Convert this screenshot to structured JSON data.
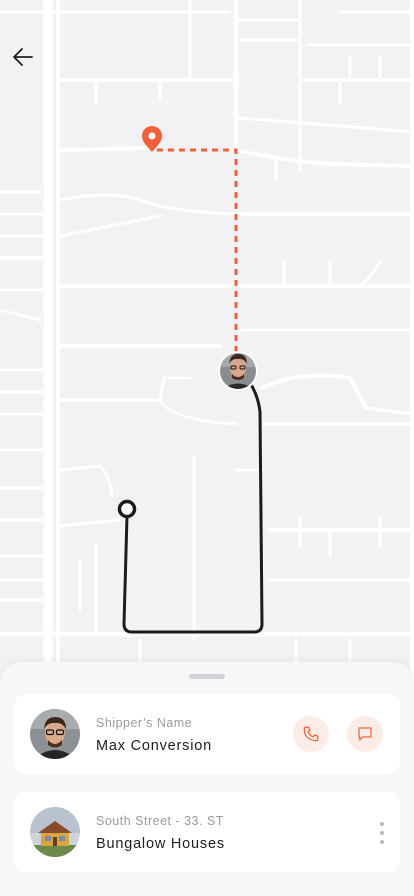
{
  "screen": {
    "title": ""
  },
  "map": {
    "route_color": "#1b1b1b",
    "pending_route_color": "#f0603b",
    "pin_color": "#f0603b",
    "road_color": "#ffffff",
    "background_color": "#f2f2f4"
  },
  "header": {
    "back_icon": "arrow-left-icon"
  },
  "shipper": {
    "label": "Shipper’s Name",
    "name": "Max Conversion",
    "call_icon": "phone-icon",
    "message_icon": "message-icon"
  },
  "destination": {
    "label": "South Street - 33. ST",
    "name": "Bungalow Houses",
    "more_icon": "more-vertical-icon"
  }
}
